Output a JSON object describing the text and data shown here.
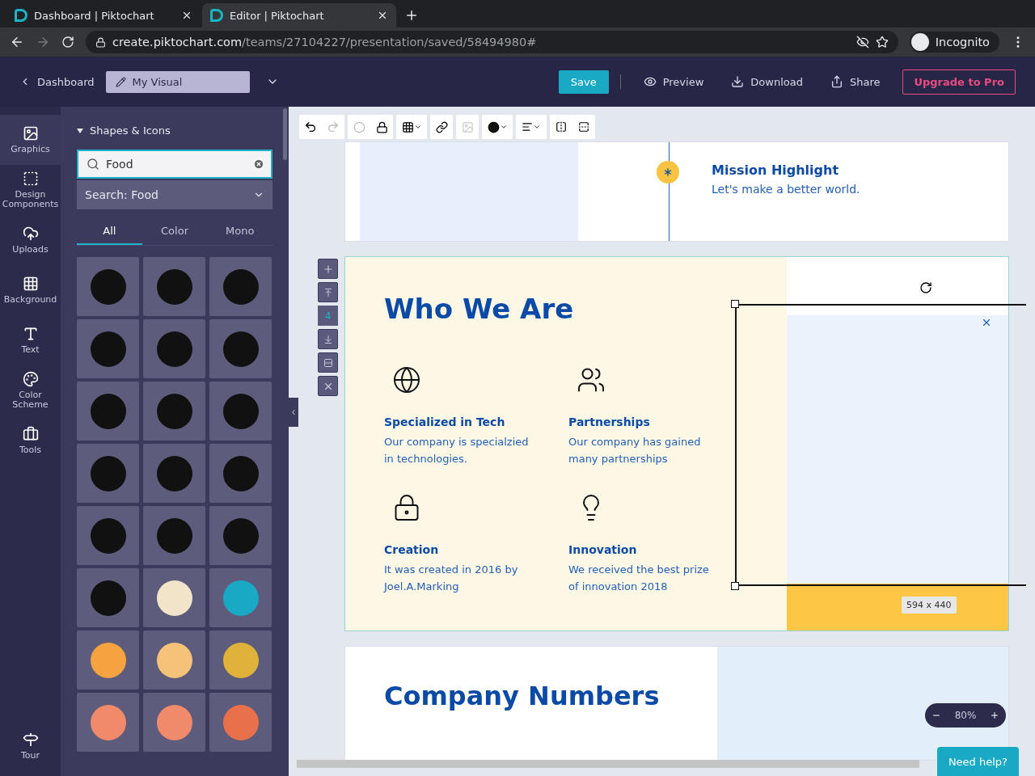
{
  "browser": {
    "tabs": [
      {
        "title": "Dashboard | Piktochart",
        "selected": false
      },
      {
        "title": "Editor | Piktochart",
        "selected": true
      }
    ],
    "url_host": "create.piktochart.com",
    "url_path": "/teams/27104227/presentation/saved/58494980#",
    "profile": "Incognito"
  },
  "header": {
    "back": "Dashboard",
    "title": "My Visual",
    "save": "Save",
    "actions": [
      "Preview",
      "Download",
      "Share"
    ],
    "upgrade": "Upgrade to Pro"
  },
  "rail": {
    "items": [
      {
        "label": "Graphics",
        "selected": true,
        "kind": "graphics"
      },
      {
        "label": "Design Components",
        "selected": false,
        "kind": "components"
      },
      {
        "label": "Uploads",
        "selected": false,
        "kind": "uploads"
      },
      {
        "label": "Background",
        "selected": false,
        "kind": "background"
      },
      {
        "label": "Text",
        "selected": false,
        "kind": "text"
      },
      {
        "label": "Color Scheme",
        "selected": false,
        "kind": "color"
      },
      {
        "label": "Tools",
        "selected": false,
        "kind": "tools"
      }
    ],
    "tour": "Tour"
  },
  "panel": {
    "section": "Shapes & Icons",
    "expanded": true,
    "search": "Food",
    "dropdown": "Search: Food",
    "filters": [
      {
        "label": "All",
        "selected": true
      },
      {
        "label": "Color",
        "selected": false
      },
      {
        "label": "Mono",
        "selected": false
      }
    ]
  },
  "slide_controls": {
    "page": "4"
  },
  "slides": {
    "mission": {
      "title": "Mission Highlight",
      "text": "Let's make a better world."
    },
    "who": {
      "title": "Who We Are",
      "features": [
        {
          "kind": "globe",
          "title": "Specialized in Tech",
          "text": "Our company is specialzied in technologies."
        },
        {
          "kind": "people",
          "title": "Partnerships",
          "text": "Our company has gained many partnerships"
        },
        {
          "kind": "lock",
          "title": "Creation",
          "text": "It was created in 2016 by Joel.A.Marking"
        },
        {
          "kind": "bulb",
          "title": "Innovation",
          "text": "We received the best prize of innovation 2018"
        }
      ]
    },
    "numbers": {
      "title": "Company Numbers"
    }
  },
  "selection": {
    "size": "594 x 440"
  },
  "zoom": "80%",
  "help": "Need help?"
}
